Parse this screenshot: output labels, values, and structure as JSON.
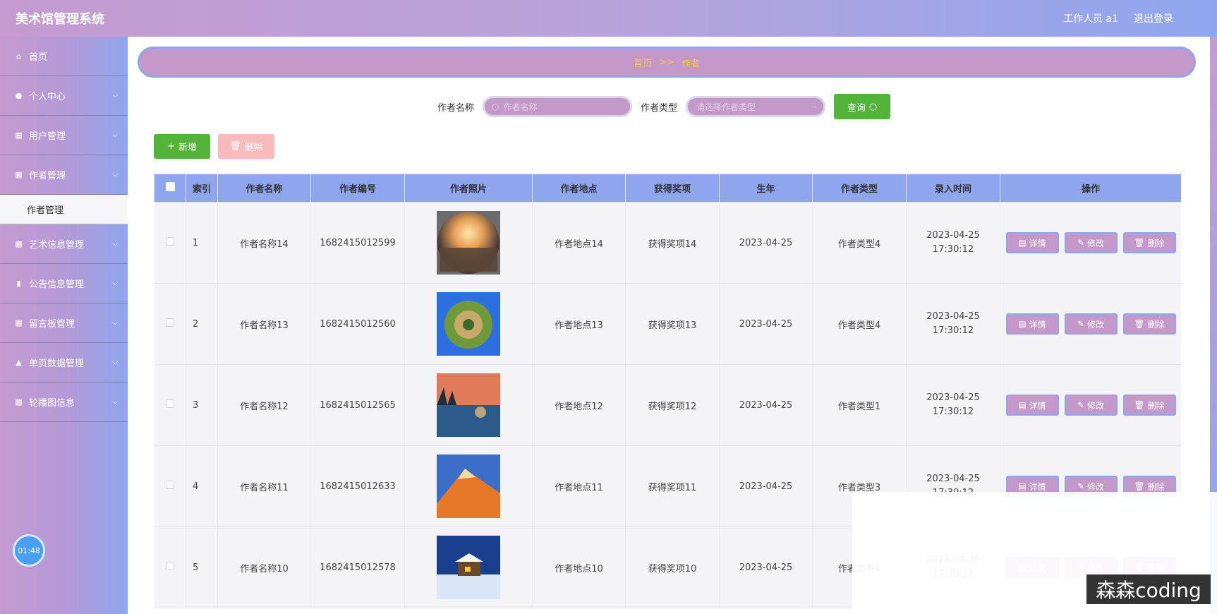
{
  "header": {
    "title": "美术馆管理系统",
    "user": "工作人员 a1",
    "logout": "退出登录"
  },
  "sidebar": {
    "items": [
      {
        "label": "首页",
        "icon": "home-icon"
      },
      {
        "label": "个人中心",
        "icon": "user-icon"
      },
      {
        "label": "用户管理",
        "icon": "grid-icon"
      },
      {
        "label": "作者管理",
        "icon": "grid-icon"
      },
      {
        "label": "艺术信息管理",
        "icon": "grid-icon"
      },
      {
        "label": "公告信息管理",
        "icon": "chart-icon"
      },
      {
        "label": "留言板管理",
        "icon": "grid-icon"
      },
      {
        "label": "单页数据管理",
        "icon": "thumb-icon"
      },
      {
        "label": "轮播图信息",
        "icon": "grid-icon"
      }
    ],
    "sub_item": "作者管理",
    "timer": "01:48"
  },
  "breadcrumb": {
    "home": "首页",
    "sep": ">>",
    "current": "作者"
  },
  "search": {
    "name_label": "作者名称",
    "name_placeholder": "作者名称",
    "type_label": "作者类型",
    "type_placeholder": "请选择作者类型",
    "query_label": "查询"
  },
  "actions": {
    "add_label": "新增",
    "delete_label": "删除"
  },
  "table": {
    "headers": [
      "",
      "索引",
      "作者名称",
      "作者编号",
      "作者照片",
      "作者地点",
      "获得奖项",
      "生年",
      "作者类型",
      "录入时间",
      "操作"
    ],
    "op_labels": {
      "detail": "详情",
      "edit": "修改",
      "delete": "删除"
    },
    "rows": [
      {
        "index": "1",
        "name": "作者名称14",
        "code": "1682415012599",
        "photo": "sunset-photo",
        "location": "作者地点14",
        "award": "获得奖项14",
        "year": "2023-04-25",
        "type": "作者类型4",
        "time": "2023-04-25 17:30:12"
      },
      {
        "index": "2",
        "name": "作者名称13",
        "code": "1682415012560",
        "photo": "planet-photo",
        "location": "作者地点13",
        "award": "获得奖项13",
        "year": "2023-04-25",
        "type": "作者类型4",
        "time": "2023-04-25 17:30:12"
      },
      {
        "index": "3",
        "name": "作者名称12",
        "code": "1682415012565",
        "photo": "lake-photo",
        "location": "作者地点12",
        "award": "获得奖项12",
        "year": "2023-04-25",
        "type": "作者类型1",
        "time": "2023-04-25 17:30:12"
      },
      {
        "index": "4",
        "name": "作者名称11",
        "code": "1682415012633",
        "photo": "mountain-photo",
        "location": "作者地点11",
        "award": "获得奖项11",
        "year": "2023-04-25",
        "type": "作者类型3",
        "time": "2023-04-25 17:30:12"
      },
      {
        "index": "5",
        "name": "作者名称10",
        "code": "1682415012578",
        "photo": "snow-cabin-photo",
        "location": "作者地点10",
        "award": "获得奖项10",
        "year": "2023-04-25",
        "type": "作者类型4",
        "time": "2023-04-25 17:30:12"
      }
    ]
  },
  "watermark": "森森coding"
}
